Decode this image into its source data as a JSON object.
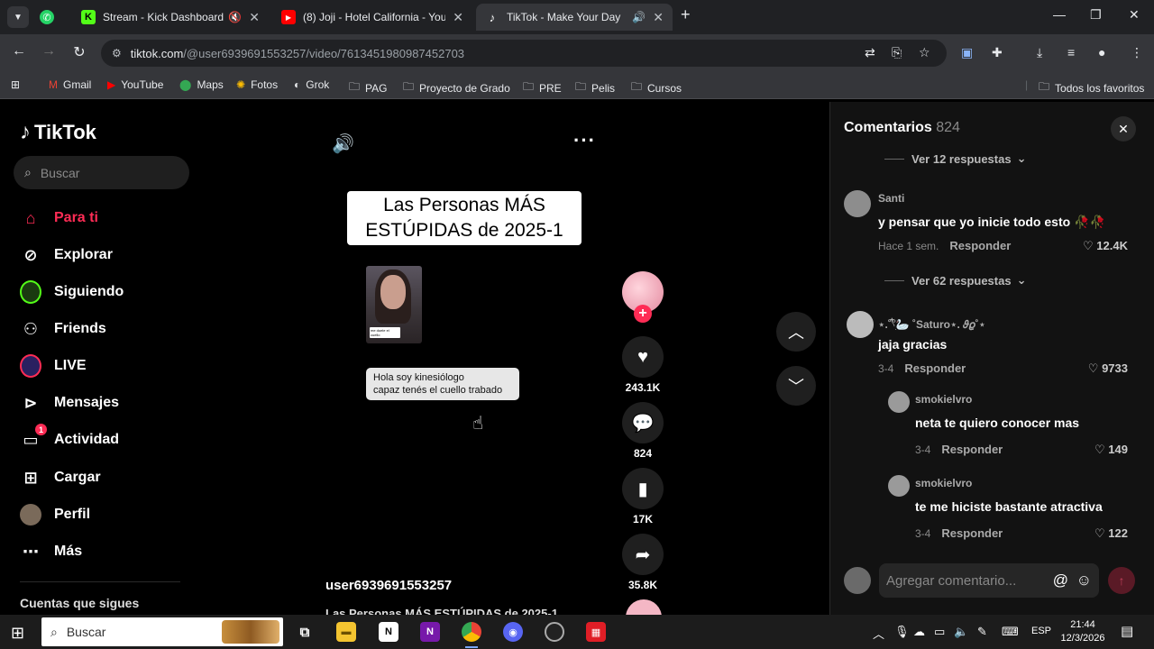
{
  "browser": {
    "tabs": [
      {
        "title": "Stream - Kick Dashboard",
        "icon": "kick-icon",
        "icon_color": "#53fc18"
      },
      {
        "title": "(8) Joji - Hotel California - YouT",
        "icon": "youtube-icon",
        "icon_color": "#ff0000"
      },
      {
        "title": "TikTok - Make Your Day",
        "icon": "tiktok-icon",
        "icon_color": "#ffffff"
      }
    ],
    "url_host": "tiktok.com",
    "url_path": "/@user6939691553257/video/7613451980987452703",
    "bookmarks": [
      "Gmail",
      "YouTube",
      "Maps",
      "Fotos",
      "Grok",
      "PAG",
      "Proyecto de Grado",
      "PRE",
      "Pelis",
      "Cursos"
    ],
    "all_bookmarks": "Todos los favoritos"
  },
  "tiktok": {
    "brand": "TikTok",
    "search_placeholder": "Buscar",
    "nav": [
      {
        "label": "Para ti",
        "icon": "home-icon",
        "active": true
      },
      {
        "label": "Explorar",
        "icon": "compass-icon"
      },
      {
        "label": "Siguiendo",
        "icon": "following-icon"
      },
      {
        "label": "Friends",
        "icon": "friends-icon"
      },
      {
        "label": "LIVE",
        "icon": "live-icon"
      },
      {
        "label": "Mensajes",
        "icon": "messages-icon"
      },
      {
        "label": "Actividad",
        "icon": "activity-icon",
        "badge": "1"
      },
      {
        "label": "Cargar",
        "icon": "upload-icon"
      },
      {
        "label": "Perfil",
        "icon": "profile-icon"
      },
      {
        "label": "Más",
        "icon": "more-icon"
      }
    ],
    "following_heading": "Cuentas que sigues",
    "accent": "#fe2c55"
  },
  "video": {
    "caption_line1": "Las Personas MÁS",
    "caption_line2": "ESTÚPIDAS de 2025-1",
    "thumb_caption": "me duele el cuello",
    "bubble_line1": "Hola soy kinesiólogo",
    "bubble_line2": "capaz tenés el cuello trabado",
    "username": "user6939691553257",
    "description": "Las Personas MÁS ESTÚPIDAS de 2025-1",
    "likes": "243.1K",
    "comments": "824",
    "saves": "17K",
    "shares": "35.8K"
  },
  "comments": {
    "title": "Comentarios",
    "count": "824",
    "replies_link_1": "Ver 12 respuestas",
    "replies_link_2": "Ver 62 respuestas",
    "items": [
      {
        "user": "Santi",
        "text": "y pensar que yo inicie todo esto 🥀🥀",
        "date": "Hace 1 sem.",
        "reply": "Responder",
        "likes": "12.4K"
      },
      {
        "user": "⋆.˚𓍢ִ໋🦢 ˚Saturo⋆. 𝜗𝜚˚⋆",
        "text": "jaja gracias",
        "date": "3-4",
        "reply": "Responder",
        "likes": "9733"
      },
      {
        "user": "smokielvro",
        "text": "neta te quiero conocer mas",
        "date": "3-4",
        "reply": "Responder",
        "likes": "149"
      },
      {
        "user": "smokielvro",
        "text": "te me hiciste bastante atractiva",
        "date": "3-4",
        "reply": "Responder",
        "likes": "122"
      }
    ],
    "input_placeholder": "Agregar comentario..."
  },
  "taskbar": {
    "search_placeholder": "Buscar",
    "language": "ESP",
    "time": "21:44",
    "date": "12/3/2026"
  }
}
